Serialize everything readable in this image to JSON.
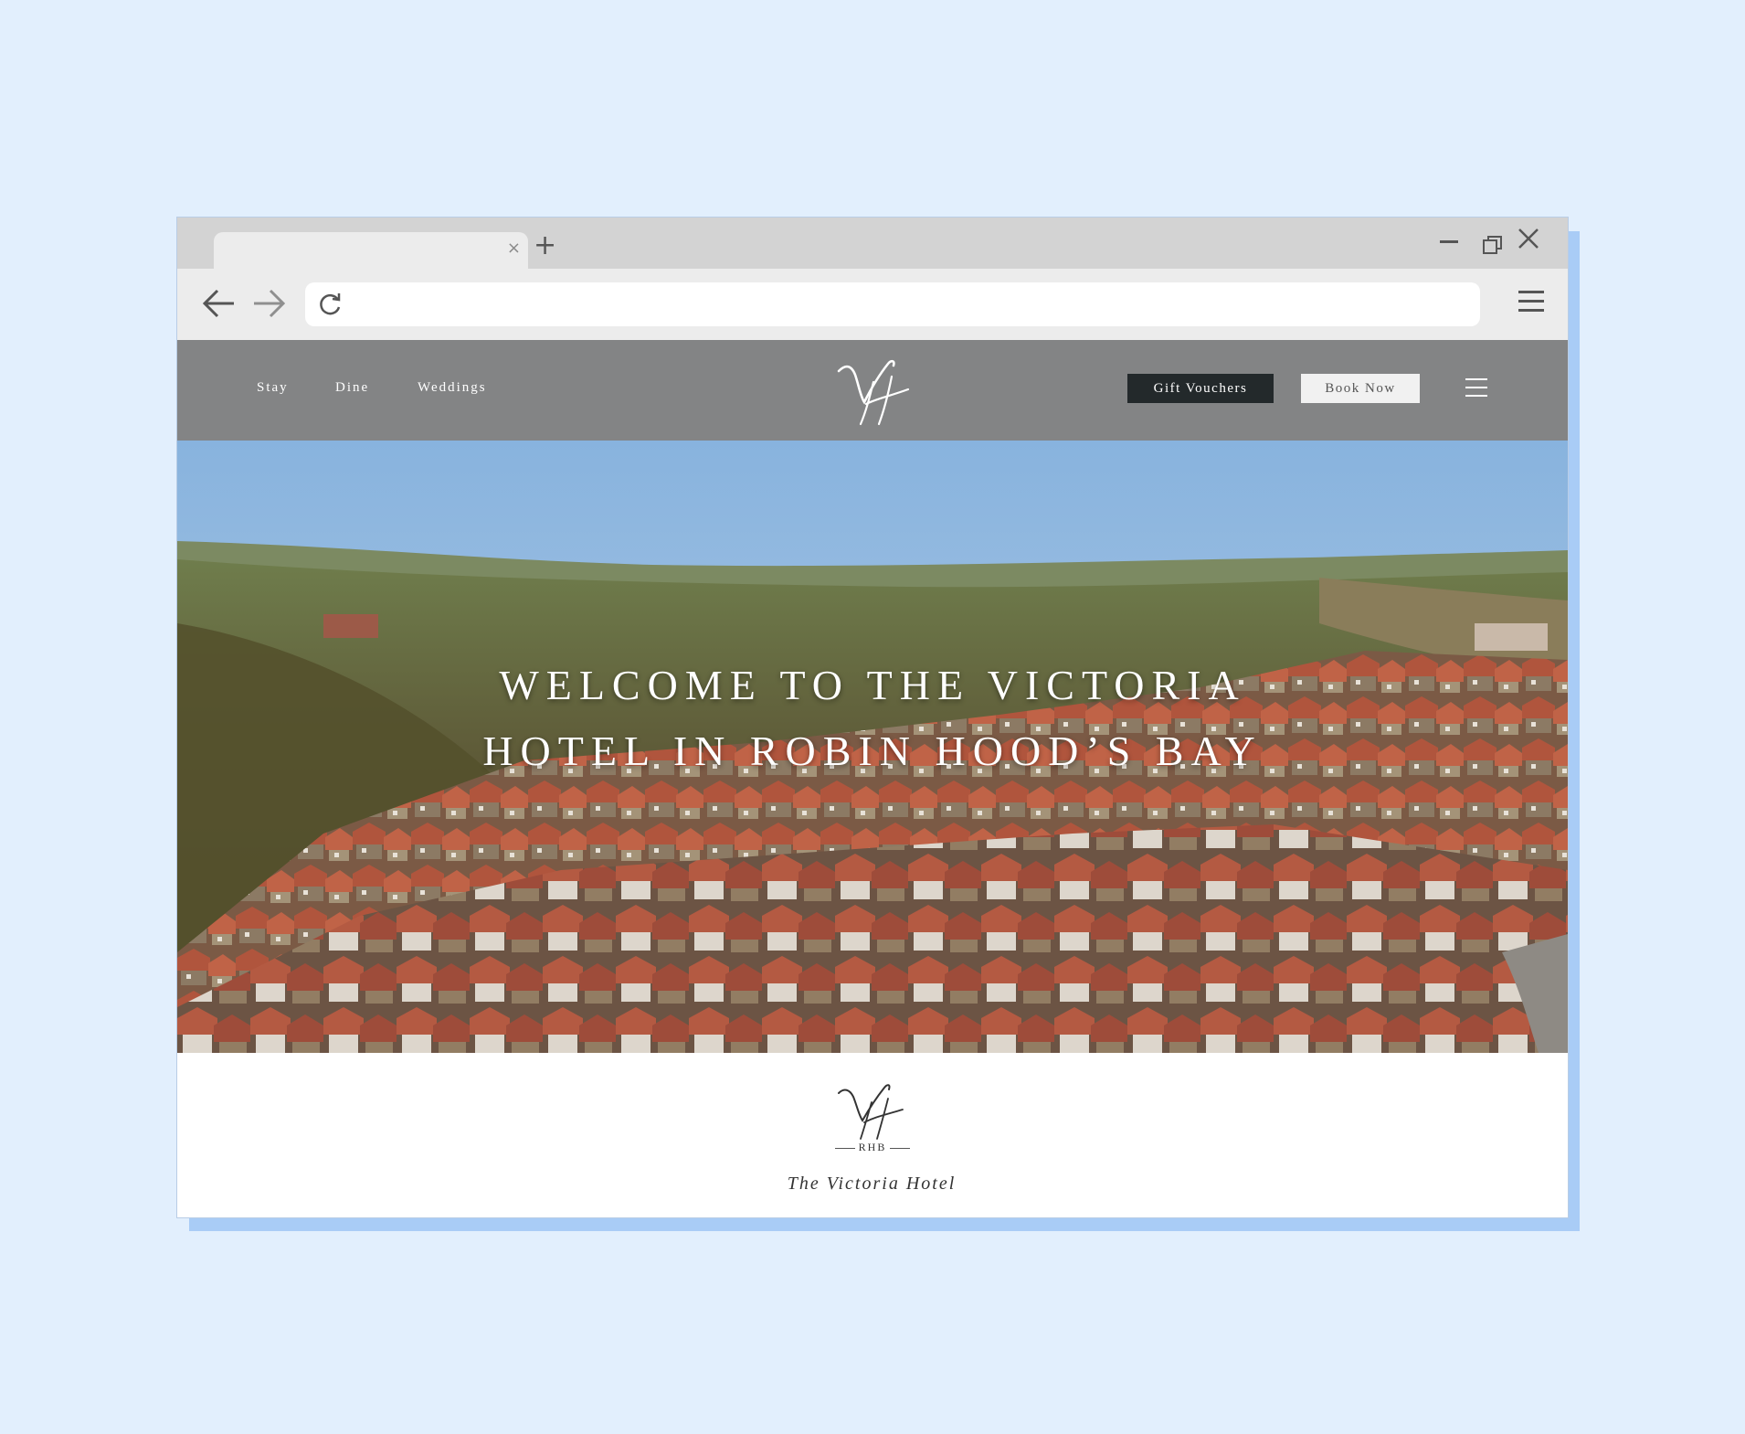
{
  "browser": {
    "tab_close_glyph": "×",
    "new_tab_glyph": "+",
    "icons": [
      "back-arrow-icon",
      "forward-arrow-icon",
      "reload-icon",
      "menu-icon",
      "minimize-icon",
      "maximize-icon",
      "close-icon"
    ]
  },
  "site": {
    "nav": [
      {
        "label": "Stay"
      },
      {
        "label": "Dine"
      },
      {
        "label": "Weddings"
      }
    ],
    "logo_monogram": "VH",
    "gift_button": "Gift Vouchers",
    "book_button": "Book Now",
    "colors": {
      "header_bg": "#838485",
      "gift_bg": "#23292b",
      "book_bg": "#f1f1f1"
    }
  },
  "hero": {
    "title": "WELCOME TO THE VICTORIA HOTEL IN ROBIN HOOD’S BAY"
  },
  "footer": {
    "logo_monogram": "VH",
    "logo_sub": "RHB",
    "hotel_name": "The Victoria Hotel"
  }
}
